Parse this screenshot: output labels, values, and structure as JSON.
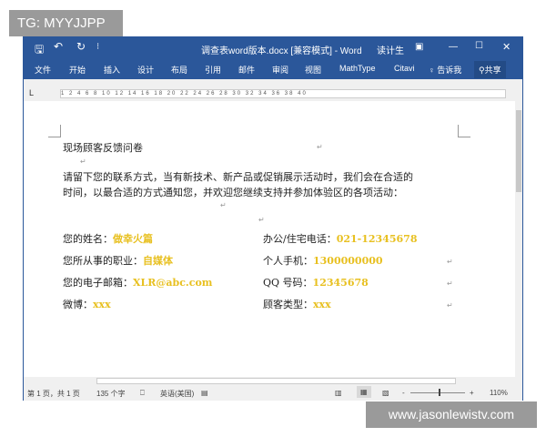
{
  "watermarks": {
    "top": "TG: MYYJJPP",
    "bottom": "www.jasonlewistv.com"
  },
  "titlebar": {
    "title": "调查表word版本.docx [兼容模式] - Word",
    "user": "读计生",
    "icons": [
      "save-icon",
      "undo-icon",
      "redo-icon",
      "customize-icon",
      "ribbon-display-icon",
      "minimize-icon",
      "maximize-icon",
      "close-icon"
    ]
  },
  "tabs": [
    "文件",
    "开始",
    "插入",
    "设计",
    "布局",
    "引用",
    "邮件",
    "审阅",
    "视图",
    "MathType",
    "Citavi"
  ],
  "tell_me": "告诉我",
  "share": "共享",
  "ruler": "1 2 4 6 8 10 12 14 16 18 20 22 24 26 28 30 32 34 36 38 40",
  "document": {
    "title": "现场顾客反馈问卷",
    "para1": "请留下您的联系方式，当有新技术、新产品或促销展示活动时，我们会在合适的",
    "para2": "时间，以最合适的方式通知您，并欢迎您继续支持并参加体验区的各项活动：",
    "fields": [
      {
        "label": "您的姓名：",
        "value": "做幸火篇"
      },
      {
        "label": "办公/住宅电话：",
        "value": "021-12345678"
      },
      {
        "label": "您所从事的职业：",
        "value": "自媒体"
      },
      {
        "label": "个人手机：",
        "value": "1300000000"
      },
      {
        "label": "您的电子邮箱：",
        "value": "XLR@abc.com"
      },
      {
        "label": "QQ 号码：",
        "value": "12345678"
      },
      {
        "label": "微博：",
        "value": "xxx"
      },
      {
        "label": "顾客类型：",
        "value": "xxx"
      }
    ]
  },
  "status": {
    "page": "第 1 页，共 1 页",
    "words": "135 个字",
    "language": "英语(美国)",
    "zoom": "110%"
  }
}
